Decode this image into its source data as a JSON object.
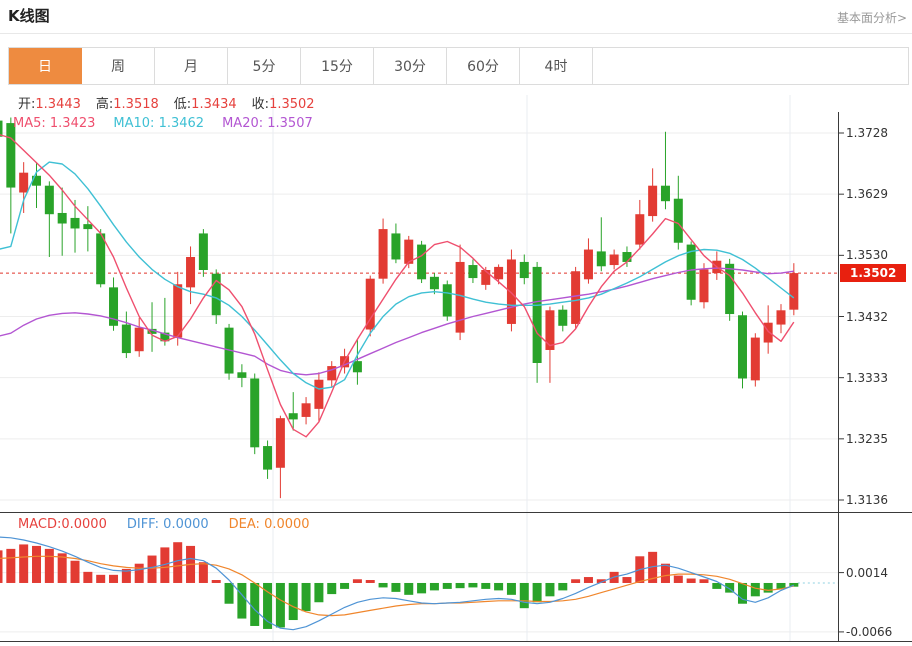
{
  "header": {
    "title": "K线图",
    "link": "基本面分析>"
  },
  "tabbar": {
    "tabs": [
      "日",
      "周",
      "月",
      "5分",
      "15分",
      "30分",
      "60分",
      "4时"
    ],
    "active": "日"
  },
  "ohlc": {
    "open_label": "开:",
    "open": "1.3443",
    "high_label": "高:",
    "high": "1.3518",
    "low_label": "低:",
    "low": "1.3434",
    "close_label": "收:",
    "close": "1.3502"
  },
  "ma_info": {
    "ma5_label": "MA5:",
    "ma5": "1.3423",
    "ma10_label": "MA10:",
    "ma10": "1.3462",
    "ma20_label": "MA20:",
    "ma20": "1.3507"
  },
  "macd_info": {
    "macd_label": "MACD:",
    "macd": "0.0000",
    "diff_label": "DIFF:",
    "diff": "0.0000",
    "dea_label": "DEA:",
    "dea": "0.0000"
  },
  "colors": {
    "up": "#e23b33",
    "down": "#29a329",
    "ma5": "#ef4f6e",
    "ma10": "#3fc0d4",
    "ma20": "#b356d2",
    "diff": "#4f94d5",
    "dea": "#f0862c",
    "dotted_price": "#e0352b",
    "dotted_zero": "#8fd2e2",
    "tab_active": "#ee8b40",
    "tag_bg": "#e8200f",
    "grid_h": "#ededed",
    "grid_v": "#e9ecf2",
    "axis": "#3a3a3a"
  },
  "chart_data": {
    "type": "candlestick",
    "title": "K线图",
    "period": "日",
    "legend": [
      "MA5",
      "MA10",
      "MA20",
      "MACD",
      "DIFF",
      "DEA"
    ],
    "last_price": 1.3502,
    "last_price_label": "1.3502",
    "y_axis": {
      "labels": [
        "1.3728",
        "1.3629",
        "1.3530",
        "1.3432",
        "1.3333",
        "1.3235",
        "1.3136"
      ],
      "max": 1.3728,
      "min": 1.3136
    },
    "candles": [
      [
        1.3748,
        1.3756,
        1.3695,
        1.3722
      ],
      [
        1.3744,
        1.3753,
        1.3566,
        1.364
      ],
      [
        1.3632,
        1.3681,
        1.3599,
        1.3664
      ],
      [
        1.3659,
        1.3681,
        1.3607,
        1.3643
      ],
      [
        1.3643,
        1.365,
        1.3528,
        1.3597
      ],
      [
        1.3599,
        1.364,
        1.353,
        1.3582
      ],
      [
        1.3591,
        1.362,
        1.3535,
        1.3574
      ],
      [
        1.3581,
        1.361,
        1.3537,
        1.3573
      ],
      [
        1.3566,
        1.3573,
        1.3479,
        1.3484
      ],
      [
        1.3479,
        1.3495,
        1.3409,
        1.3417
      ],
      [
        1.3419,
        1.344,
        1.3365,
        1.3373
      ],
      [
        1.3376,
        1.343,
        1.3367,
        1.3414
      ],
      [
        1.3412,
        1.3455,
        1.3375,
        1.3404
      ],
      [
        1.3406,
        1.3462,
        1.3385,
        1.3392
      ],
      [
        1.3398,
        1.3504,
        1.3385,
        1.3484
      ],
      [
        1.3479,
        1.3545,
        1.3452,
        1.3528
      ],
      [
        1.3566,
        1.3573,
        1.3496,
        1.3507
      ],
      [
        1.3501,
        1.3508,
        1.342,
        1.3434
      ],
      [
        1.3414,
        1.342,
        1.333,
        1.334
      ],
      [
        1.3342,
        1.3355,
        1.3318,
        1.3333
      ],
      [
        1.3332,
        1.334,
        1.321,
        1.3221
      ],
      [
        1.3223,
        1.3232,
        1.317,
        1.3185
      ],
      [
        1.3188,
        1.3272,
        1.3139,
        1.3268
      ],
      [
        1.3276,
        1.331,
        1.3248,
        1.3266
      ],
      [
        1.327,
        1.3302,
        1.3258,
        1.3292
      ],
      [
        1.3283,
        1.3342,
        1.3262,
        1.333
      ],
      [
        1.3329,
        1.336,
        1.3318,
        1.3352
      ],
      [
        1.335,
        1.338,
        1.334,
        1.3368
      ],
      [
        1.336,
        1.3395,
        1.3322,
        1.3342
      ],
      [
        1.3411,
        1.3498,
        1.34,
        1.3493
      ],
      [
        1.3493,
        1.359,
        1.3485,
        1.3573
      ],
      [
        1.3566,
        1.3582,
        1.3518,
        1.3524
      ],
      [
        1.3517,
        1.3562,
        1.351,
        1.3556
      ],
      [
        1.3548,
        1.3554,
        1.3486,
        1.3492
      ],
      [
        1.3496,
        1.3502,
        1.3468,
        1.3476
      ],
      [
        1.3484,
        1.349,
        1.3425,
        1.3432
      ],
      [
        1.3406,
        1.3548,
        1.3394,
        1.352
      ],
      [
        1.3515,
        1.3524,
        1.3486,
        1.3494
      ],
      [
        1.3483,
        1.3512,
        1.3475,
        1.3507
      ],
      [
        1.3492,
        1.3516,
        1.3484,
        1.3512
      ],
      [
        1.342,
        1.354,
        1.3408,
        1.3524
      ],
      [
        1.352,
        1.3532,
        1.3484,
        1.3494
      ],
      [
        1.3512,
        1.352,
        1.3325,
        1.3357
      ],
      [
        1.3378,
        1.3448,
        1.3325,
        1.3442
      ],
      [
        1.3443,
        1.345,
        1.3408,
        1.3417
      ],
      [
        1.342,
        1.3512,
        1.3412,
        1.3505
      ],
      [
        1.3492,
        1.3558,
        1.3485,
        1.354
      ],
      [
        1.3537,
        1.3592,
        1.3505,
        1.3513
      ],
      [
        1.3515,
        1.354,
        1.3508,
        1.3532
      ],
      [
        1.3536,
        1.3545,
        1.3512,
        1.352
      ],
      [
        1.3548,
        1.362,
        1.354,
        1.3597
      ],
      [
        1.3594,
        1.3671,
        1.3585,
        1.3643
      ],
      [
        1.3643,
        1.373,
        1.3605,
        1.3618
      ],
      [
        1.3622,
        1.3659,
        1.354,
        1.3551
      ],
      [
        1.3548,
        1.3553,
        1.345,
        1.3459
      ],
      [
        1.3455,
        1.3518,
        1.3445,
        1.3508
      ],
      [
        1.3502,
        1.3537,
        1.3491,
        1.3522
      ],
      [
        1.3517,
        1.3525,
        1.3425,
        1.3436
      ],
      [
        1.3434,
        1.344,
        1.3316,
        1.3332
      ],
      [
        1.3329,
        1.3405,
        1.3319,
        1.3398
      ],
      [
        1.339,
        1.345,
        1.3372,
        1.3422
      ],
      [
        1.3419,
        1.3452,
        1.3405,
        1.3442
      ],
      [
        1.3443,
        1.3518,
        1.3434,
        1.3502
      ]
    ],
    "ma5": [
      1.3726,
      1.372,
      1.37,
      1.368,
      1.366,
      1.3636,
      1.361,
      1.3588,
      1.3566,
      1.3528,
      1.3478,
      1.3432,
      1.3402,
      1.3392,
      1.34,
      1.3428,
      1.3462,
      1.349,
      1.3475,
      1.3448,
      1.3404,
      1.3346,
      1.329,
      1.325,
      1.3238,
      1.3262,
      1.331,
      1.336,
      1.3395,
      1.3428,
      1.346,
      1.3492,
      1.352,
      1.353,
      1.3548,
      1.3553,
      1.3544,
      1.3526,
      1.3505,
      1.3488,
      1.347,
      1.3448,
      1.3405,
      1.3385,
      1.339,
      1.3412,
      1.3448,
      1.348,
      1.3505,
      1.352,
      1.3542,
      1.3565,
      1.359,
      1.3582,
      1.3556,
      1.353,
      1.3512,
      1.3498,
      1.347,
      1.3438,
      1.3408,
      1.3392,
      1.3423
    ],
    "ma10": [
      1.354,
      1.3545,
      1.362,
      1.3665,
      1.3681,
      1.3678,
      1.3662,
      1.3638,
      1.361,
      1.358,
      1.3552,
      1.3528,
      1.3508,
      1.3492,
      1.348,
      1.3472,
      1.3468,
      1.3462,
      1.345,
      1.3432,
      1.341,
      1.3386,
      1.3362,
      1.334,
      1.3325,
      1.3315,
      1.3318,
      1.333,
      1.337,
      1.3405,
      1.3432,
      1.3452,
      1.3464,
      1.347,
      1.3472,
      1.347,
      1.3466,
      1.346,
      1.3455,
      1.3452,
      1.345,
      1.345,
      1.345,
      1.3452,
      1.3455,
      1.3458,
      1.3462,
      1.3468,
      1.3477,
      1.3486,
      1.3496,
      1.3508,
      1.352,
      1.353,
      1.3537,
      1.354,
      1.3539,
      1.3534,
      1.3524,
      1.351,
      1.3494,
      1.3478,
      1.3462
    ],
    "ma20": [
      1.34,
      1.3405,
      1.3418,
      1.3428,
      1.3434,
      1.3437,
      1.3438,
      1.3436,
      1.3433,
      1.3428,
      1.3422,
      1.3415,
      1.341,
      1.3404,
      1.3398,
      1.3393,
      1.3388,
      1.3383,
      1.3378,
      1.3373,
      1.3368,
      1.3355,
      1.3345,
      1.334,
      1.3338,
      1.334,
      1.3346,
      1.3354,
      1.3363,
      1.3372,
      1.3381,
      1.339,
      1.3398,
      1.3406,
      1.3413,
      1.342,
      1.3426,
      1.3432,
      1.3437,
      1.3442,
      1.3447,
      1.3452,
      1.3456,
      1.3459,
      1.3462,
      1.3465,
      1.3468,
      1.3472,
      1.3476,
      1.3481,
      1.3487,
      1.3493,
      1.3498,
      1.3503,
      1.3507,
      1.3509,
      1.351,
      1.3509,
      1.3507,
      1.3504,
      1.3501,
      1.3502,
      1.3505
    ],
    "macd": {
      "y_labels": [
        "0.0014",
        "-0.0066"
      ],
      "y_label_values": [
        0.0014,
        -0.0066
      ],
      "bars": [
        0.0044,
        0.0046,
        0.0052,
        0.005,
        0.0046,
        0.004,
        0.003,
        0.0015,
        0.0011,
        0.0011,
        0.0019,
        0.0026,
        0.0037,
        0.0048,
        0.0055,
        0.005,
        0.0028,
        0.0004,
        -0.0028,
        -0.0048,
        -0.0058,
        -0.0062,
        -0.006,
        -0.005,
        -0.0038,
        -0.0026,
        -0.0015,
        -0.0008,
        0.0005,
        0.0004,
        -0.0006,
        -0.0012,
        -0.0016,
        -0.0014,
        -0.001,
        -0.0008,
        -0.0007,
        -0.0006,
        -0.0008,
        -0.001,
        -0.0016,
        -0.0034,
        -0.0026,
        -0.0018,
        -0.001,
        0.0005,
        0.0008,
        0.0005,
        0.0015,
        0.0008,
        0.0036,
        0.0042,
        0.0026,
        0.001,
        0.0006,
        0.0005,
        -0.0008,
        -0.0013,
        -0.0028,
        -0.0018,
        -0.0013,
        -0.0008,
        -0.0005
      ],
      "diff": [
        0.0062,
        0.0061,
        0.0058,
        0.0054,
        0.0049,
        0.0043,
        0.0036,
        0.0028,
        0.0021,
        0.0017,
        0.0016,
        0.0018,
        0.0021,
        0.0025,
        0.003,
        0.0033,
        0.003,
        0.002,
        0.0004,
        -0.0016,
        -0.0036,
        -0.0052,
        -0.0061,
        -0.0063,
        -0.0059,
        -0.0051,
        -0.0042,
        -0.0033,
        -0.0026,
        -0.0022,
        -0.002,
        -0.0021,
        -0.0024,
        -0.0027,
        -0.0028,
        -0.0027,
        -0.0026,
        -0.0024,
        -0.0022,
        -0.0021,
        -0.0022,
        -0.0026,
        -0.0028,
        -0.0026,
        -0.0021,
        -0.0014,
        -0.0006,
        0.0001,
        0.0008,
        0.0012,
        0.0018,
        0.0022,
        0.0024,
        0.002,
        0.0014,
        0.0008,
        0.0002,
        -0.0008,
        -0.0022,
        -0.0026,
        -0.002,
        -0.001,
        -0.0003
      ],
      "dea": [
        0.0033,
        0.0034,
        0.0035,
        0.0036,
        0.0036,
        0.0035,
        0.0033,
        0.003,
        0.0026,
        0.0023,
        0.0021,
        0.002,
        0.002,
        0.0021,
        0.0023,
        0.0025,
        0.0026,
        0.0024,
        0.0019,
        0.0011,
        0.0,
        -0.0012,
        -0.0023,
        -0.0032,
        -0.0039,
        -0.0043,
        -0.0044,
        -0.0043,
        -0.004,
        -0.0037,
        -0.0034,
        -0.0031,
        -0.0029,
        -0.0028,
        -0.0028,
        -0.0027,
        -0.0027,
        -0.0026,
        -0.0025,
        -0.0024,
        -0.0024,
        -0.0024,
        -0.0025,
        -0.0025,
        -0.0024,
        -0.0022,
        -0.0018,
        -0.0013,
        -0.0008,
        -0.0003,
        0.0002,
        0.0006,
        0.001,
        0.0012,
        0.0012,
        0.0011,
        0.0009,
        0.0005,
        -0.0001,
        -0.0007,
        -0.001,
        -0.0008,
        -0.0004
      ]
    }
  }
}
